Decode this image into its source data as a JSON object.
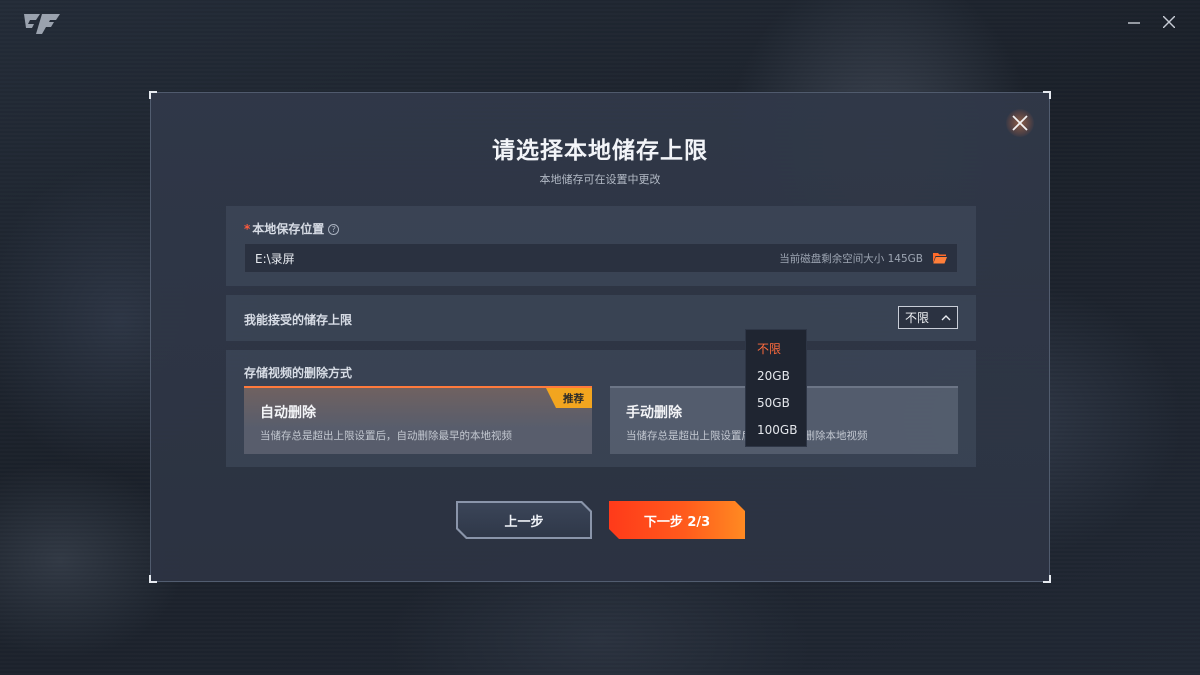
{
  "window": {
    "minimize_label": "—",
    "close_label": "✕"
  },
  "dialog": {
    "title": "请选择本地储存上限",
    "subtitle": "本地储存可在设置中更改",
    "close_icon": "close-icon"
  },
  "location": {
    "label": "本地保存位置",
    "required_mark": "*",
    "help_glyph": "?",
    "path_value": "E:\\录屏",
    "free_space": "当前磁盘剩余空间大小 145GB",
    "folder_icon": "folder-icon"
  },
  "limit": {
    "label": "我能接受的储存上限",
    "selected": "不限",
    "options": [
      "不限",
      "20GB",
      "50GB",
      "100GB"
    ]
  },
  "delete_mode": {
    "label": "存储视频的删除方式",
    "options": [
      {
        "title": "自动删除",
        "description": "当储存总是超出上限设置后，自动删除最早的本地视频",
        "badge": "推荐"
      },
      {
        "title": "手动删除",
        "description": "当储存总是超出上限设置后，需要手动删除本地视频"
      }
    ]
  },
  "buttons": {
    "prev_label": "上一步",
    "next_label": "下一步 2/3"
  },
  "colors": {
    "accent": "#ff5a1c",
    "badge": "#f2a51f",
    "selected_option": "#ff6b3d"
  }
}
